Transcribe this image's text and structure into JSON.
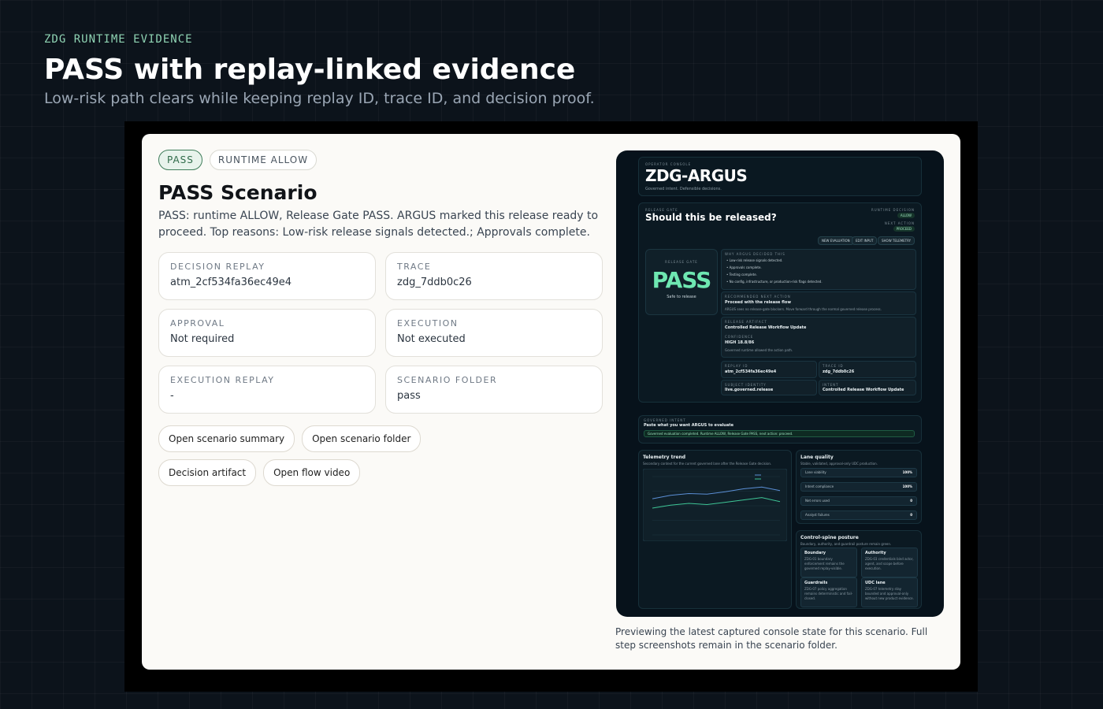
{
  "header": {
    "eyebrow": "ZDG RUNTIME EVIDENCE",
    "title": "PASS with replay-linked evidence",
    "subtitle": "Low-risk path clears while keeping replay ID, trace ID, and decision proof."
  },
  "scenario": {
    "chips": [
      "PASS",
      "RUNTIME ALLOW"
    ],
    "title": "PASS Scenario",
    "description": "PASS: runtime ALLOW, Release Gate PASS. ARGUS marked this release ready to proceed. Top reasons: Low-risk release signals detected.; Approvals complete.",
    "fields": [
      {
        "label": "DECISION REPLAY",
        "value": "atm_2cf534fa36ec49e4"
      },
      {
        "label": "TRACE",
        "value": "zdg_7ddb0c26"
      },
      {
        "label": "APPROVAL",
        "value": "Not required"
      },
      {
        "label": "EXECUTION",
        "value": "Not executed"
      },
      {
        "label": "EXECUTION REPLAY",
        "value": "-"
      },
      {
        "label": "SCENARIO FOLDER",
        "value": "pass"
      }
    ],
    "links": [
      "Open scenario summary",
      "Open scenario folder",
      "Decision artifact",
      "Open flow video"
    ]
  },
  "preview": {
    "caption": "Previewing the latest captured console state for this scenario. Full step screenshots remain in the scenario folder.",
    "console": {
      "eyebrow": "OPERATOR CONSOLE",
      "brand": "ZDG-ARGUS",
      "tagline": "Governed intent. Defensible decisions.",
      "gate_label": "RELEASE GATE",
      "question": "Should this be released?",
      "runtime_decision_label": "RUNTIME DECISION",
      "runtime_decision": "ALLOW",
      "next_action_label": "NEXT ACTION",
      "next_action": "PROCEED",
      "actions": [
        "NEW EVALUATION",
        "EDIT INPUT",
        "SHOW TELEMETRY"
      ],
      "verdict_label": "RELEASE GATE",
      "verdict": "PASS",
      "verdict_sub": "Safe to release",
      "why_label": "WHY ARGUS DECIDED THIS",
      "reasons": [
        "• Low-risk release signals detected.",
        "• Approvals complete.",
        "• Testing complete.",
        "• No config, infrastructure, or production-risk flags detected."
      ],
      "rec_label": "RECOMMENDED NEXT ACTION",
      "rec_title": "Proceed with the release flow",
      "rec_text": "ARGUS sees no release-gate blockers. Move forward through the normal governed release process.",
      "artifact_label": "RELEASE ARTIFACT",
      "artifact": "Controlled Release Workflow Update",
      "confidence_label": "CONFIDENCE",
      "confidence": "HIGH 18.8/86",
      "confidence_note": "Governed runtime allowed the action path.",
      "replay_label": "REPLAY ID",
      "replay": "atm_2cf534fa36ec49e4",
      "trace_label": "TRACE ID",
      "trace": "zdg_7ddb0c26",
      "subject_label": "SUBJECT IDENTITY",
      "subject": "live.governed.release",
      "intent_label": "INTENT",
      "intent": "Controlled Release Workflow Update",
      "input_label": "GOVERNED INTENT",
      "input_title": "Paste what you want ARGUS to evaluate",
      "status": "Governed evaluation completed. Runtime ALLOW, Release Gate PASS, next action: proceed.",
      "telemetry_title": "Telemetry trend",
      "telemetry_sub": "Secondary context for the current governed lane after the Release Gate decision.",
      "lane_title": "Lane quality",
      "lane_sub": "Stable, validated, approval-only UDC production.",
      "lane_rows": [
        {
          "label": "Lane viability",
          "value": "100%"
        },
        {
          "label": "Intent compliance",
          "value": "100%"
        },
        {
          "label": "Net errors used",
          "value": "0"
        },
        {
          "label": "Analyst failures",
          "value": "0"
        }
      ],
      "spine_title": "Control-spine posture",
      "spine_sub": "Boundary, authority, and guardrail posture remain green.",
      "spine_boxes": [
        {
          "title": "Boundary",
          "text": "ZDG-01 boundary enforcement remains the governed replay-visible."
        },
        {
          "title": "Authority",
          "text": "ZDG-03 credentials bind actor, agent, and scope before execution."
        },
        {
          "title": "Guardrails",
          "text": "ZDG-07 policy aggregation remains deterministic and fail-closed."
        },
        {
          "title": "UDC lane",
          "text": "ZDG-07 telemetry stay bounded and approval-only without new product evidence."
        }
      ]
    }
  },
  "colors": {
    "pass_green": "#6ee7b1",
    "accent_green": "#3f7d5a",
    "console_bg": "#07121b"
  },
  "chart_data": {
    "type": "line",
    "title": "Telemetry trend",
    "x": [
      "",
      "",
      "",
      "",
      "",
      "",
      "",
      "",
      ""
    ],
    "series": [
      {
        "values": [
          0.62,
          0.68,
          0.71,
          0.7,
          0.74,
          0.79,
          0.82,
          0.76
        ]
      },
      {
        "values": [
          0.46,
          0.51,
          0.54,
          0.52,
          0.56,
          0.6,
          0.64,
          0.57
        ]
      }
    ],
    "ylim": [
      0,
      1
    ],
    "grid": true
  }
}
